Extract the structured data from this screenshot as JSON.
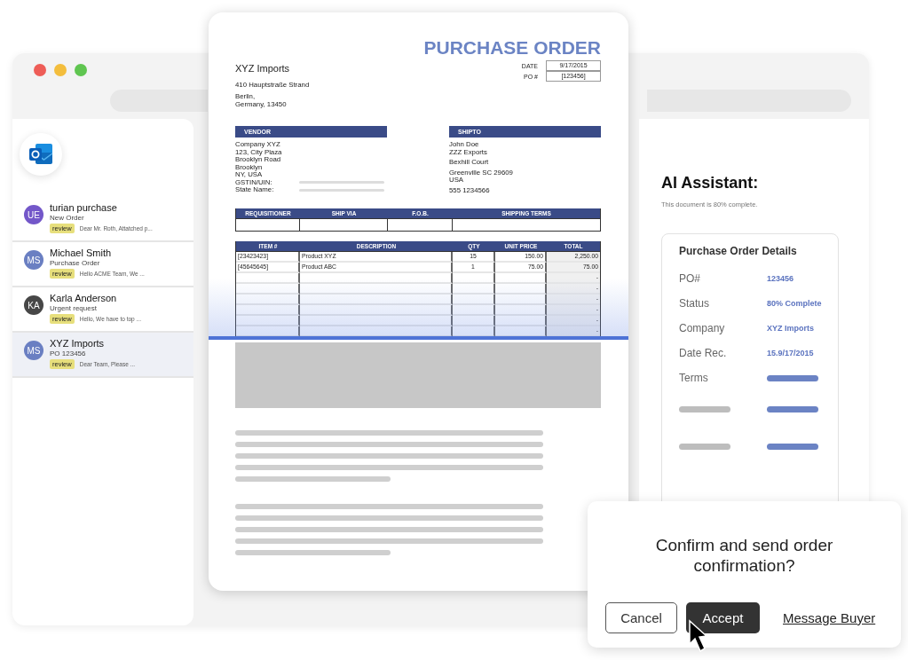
{
  "mail_list": [
    {
      "initials": "UE",
      "color": "#7357c9",
      "sender": "turian purchase",
      "subject": "New Order",
      "tag": "review",
      "preview": "Dear Mr. Roth, Attatched p...",
      "selected": false
    },
    {
      "initials": "MS",
      "color": "#6a7fc2",
      "sender": "Michael Smith",
      "subject": "Purchase Order",
      "tag": "review",
      "preview": "Hello ACME Team, We ...",
      "selected": false
    },
    {
      "initials": "KA",
      "color": "#474747",
      "sender": "Karla Anderson",
      "subject": "Urgent request",
      "tag": "review",
      "preview": "Hello, We have to top ...",
      "selected": false
    },
    {
      "initials": "MS",
      "color": "#6a7fc2",
      "sender": "XYZ Imports",
      "subject": "PO 123456",
      "tag": "review",
      "preview": "Dear Team, Please ...",
      "selected": true
    }
  ],
  "document": {
    "title": "PURCHASE ORDER",
    "company": "XYZ Imports",
    "street": "410 Hauptstraße Strand",
    "city_lines": [
      "Berlin,",
      "Germany, 13450"
    ],
    "meta": [
      {
        "label": "DATE",
        "value": "9/17/2015"
      },
      {
        "label": "PO #",
        "value": "[123456]"
      }
    ],
    "vendor": {
      "heading": "VENDOR",
      "lines": [
        "Company XYZ",
        "123, City Plaza",
        "Brooklyn Road",
        "Brooklyn",
        "NY, USA"
      ],
      "fields": [
        "GSTIN/UIN:",
        "State Name:"
      ]
    },
    "ship_to": {
      "heading": "SHIPTO",
      "lines": [
        "John Doe",
        "ZZZ Exports",
        "Bexhill Court",
        "Greenville SC 29609",
        "USA",
        "555 1234566"
      ]
    },
    "shipping_columns": [
      "REQUISITIONER",
      "SHIP VIA",
      "F.O.B.",
      "SHIPPING TERMS"
    ],
    "item_columns": [
      "ITEM #",
      "DESCRIPTION",
      "QTY",
      "UNIT PRICE",
      "TOTAL"
    ],
    "item_rows": [
      {
        "item": "[23423423]",
        "description": "Product XYZ",
        "qty": "15",
        "unit_price": "150.00",
        "total": "2,250.00"
      },
      {
        "item": "[45645645]",
        "description": "Product ABC",
        "qty": "1",
        "unit_price": "75.00",
        "total": "75.00"
      },
      {
        "total": "-"
      },
      {
        "total": "-"
      },
      {
        "total": "-"
      },
      {
        "total": "-"
      },
      {
        "total": "-"
      },
      {
        "total": "-"
      }
    ]
  },
  "assistant": {
    "title": "AI Assistant:",
    "subtitle": "This document is 80% complete.",
    "card": {
      "title": "Purchase Order Details",
      "fields": [
        {
          "label": "PO#",
          "value": "123456"
        },
        {
          "label": "Status",
          "value": "80% Complete"
        },
        {
          "label": "Company",
          "value": "XYZ Imports"
        },
        {
          "label": "Date Rec.",
          "value": "15.9/17/2015"
        },
        {
          "label": "Terms"
        }
      ]
    }
  },
  "dialog": {
    "message": "Confirm and send order confirmation?",
    "cancel": "Cancel",
    "accept": "Accept",
    "link": "Message Buyer"
  }
}
